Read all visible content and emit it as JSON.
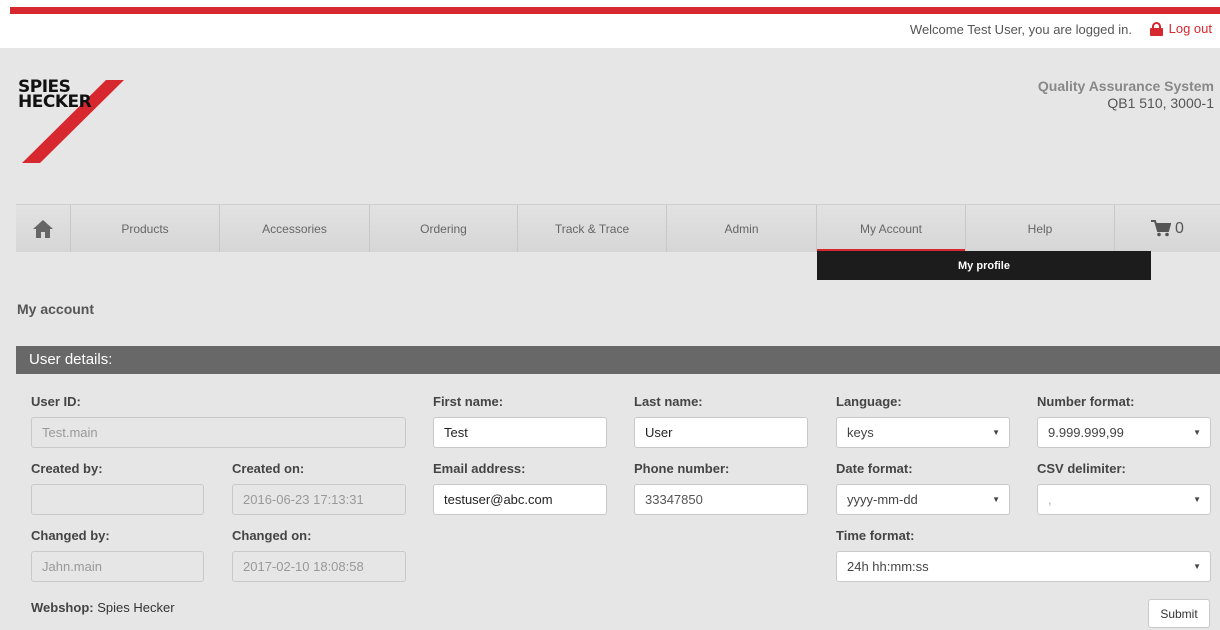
{
  "header": {
    "welcome": "Welcome Test User, you are logged in.",
    "logout": "Log out"
  },
  "logo": {
    "line1": "SPIES",
    "line2": "HECKER"
  },
  "system": {
    "name": "Quality Assurance System",
    "code": "QB1 510, 3000-1"
  },
  "nav": {
    "items": [
      "Products",
      "Accessories",
      "Ordering",
      "Track & Trace",
      "Admin",
      "My Account",
      "Help"
    ],
    "cart_count": "0",
    "active": "My Account"
  },
  "submenu": {
    "label": "My profile"
  },
  "page": {
    "title": "My account"
  },
  "section": {
    "title": "User details:"
  },
  "form": {
    "user_id": {
      "label": "User ID:",
      "value": "Test.main"
    },
    "created_by": {
      "label": "Created by:",
      "value": ""
    },
    "created_on": {
      "label": "Created on:",
      "value": "2016-06-23 17:13:31"
    },
    "changed_by": {
      "label": "Changed by:",
      "value": "Jahn.main"
    },
    "changed_on": {
      "label": "Changed on:",
      "value": "2017-02-10 18:08:58"
    },
    "first_name": {
      "label": "First name:",
      "value": "Test"
    },
    "last_name": {
      "label": "Last name:",
      "value": "User"
    },
    "email": {
      "label": "Email address:",
      "value": "testuser@abc.com"
    },
    "phone": {
      "label": "Phone number:",
      "value": "33347850"
    },
    "language": {
      "label": "Language:",
      "value": "keys"
    },
    "number_format": {
      "label": "Number format:",
      "value": "9.999.999,99"
    },
    "date_format": {
      "label": "Date format:",
      "value": "yyyy-mm-dd"
    },
    "csv_delimiter": {
      "label": "CSV delimiter:",
      "value": ","
    },
    "time_format": {
      "label": "Time format:",
      "value": "24h hh:mm:ss"
    },
    "webshop_label": "Webshop:",
    "webshop_value": "Spies Hecker",
    "submit": "Submit"
  },
  "colors": {
    "accent": "#d7282f",
    "section": "#686868",
    "background": "#e6e6e6"
  }
}
